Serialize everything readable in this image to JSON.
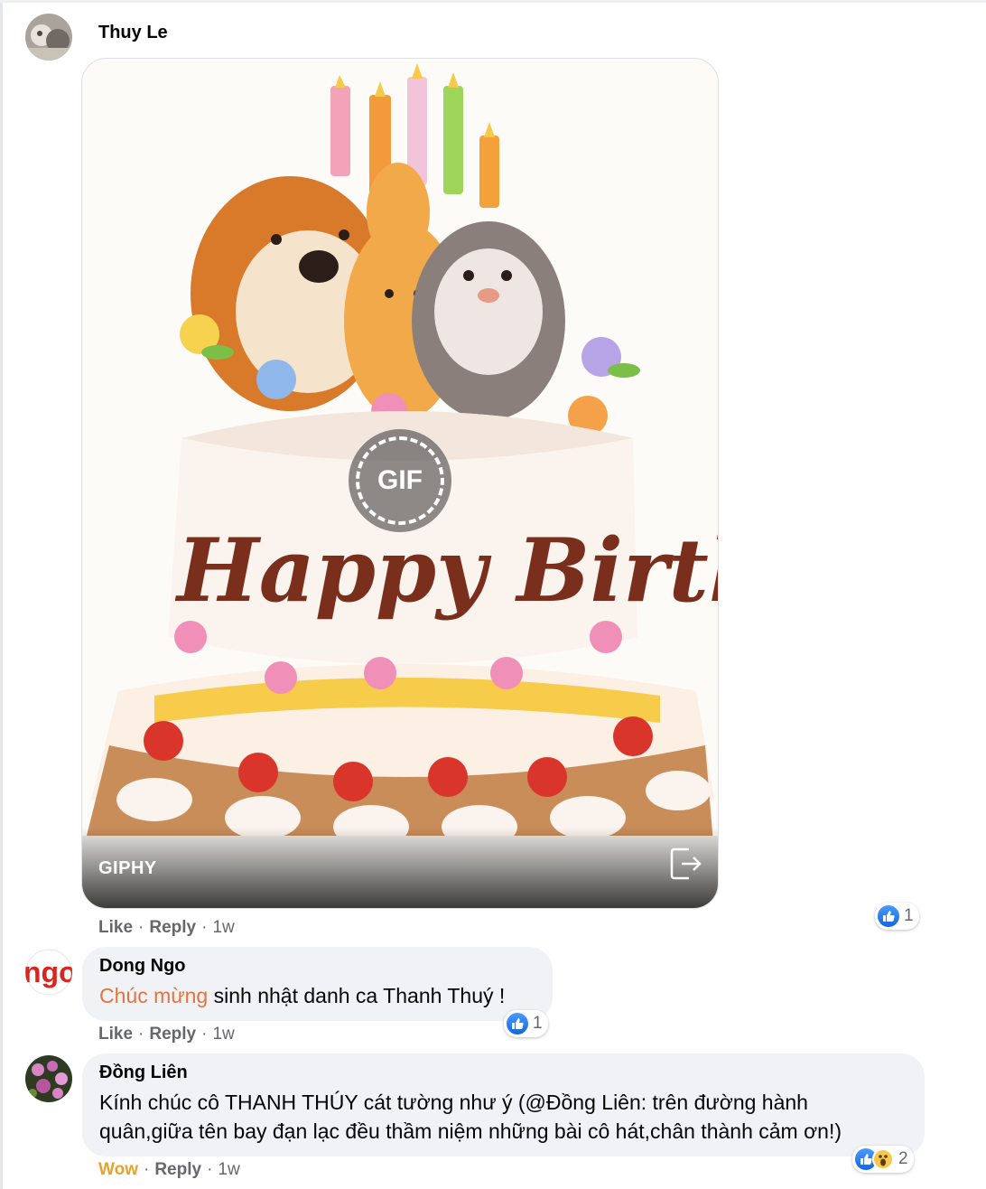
{
  "comments": [
    {
      "author": "Thuy Le",
      "media": {
        "type": "gif",
        "provider": "GIPHY",
        "badge": "GIF",
        "caption_art": "Happy Birthday"
      },
      "actions": {
        "like": "Like",
        "reply": "Reply",
        "time": "1w"
      },
      "reactions": {
        "count": "1",
        "types": [
          "like-icon"
        ]
      }
    },
    {
      "author": "Dong Ngo",
      "text_highlight": "Chúc mừng",
      "text_rest": " sinh nhật danh ca Thanh Thuý !",
      "actions": {
        "like": "Like",
        "reply": "Reply",
        "time": "1w"
      },
      "reactions": {
        "count": "1",
        "types": [
          "like-icon"
        ]
      }
    },
    {
      "author": "Đồng Liên",
      "text_line1": "Kính chúc cô THANH THÚY cát tường như ý (@Đồng Liên: trên đường hành",
      "text_line2": "quân,giữa tên bay đạn lạc đều thầm niệm những bài cô hát,chân thành cảm ơn!)",
      "actions": {
        "like": "Wow",
        "reply": "Reply",
        "time": "1w"
      },
      "reactions": {
        "count": "2",
        "types": [
          "like-icon",
          "wow-icon"
        ]
      }
    }
  ],
  "colors": {
    "bubble": "#f0f2f5",
    "link_highlight": "#e4743d",
    "wow_label": "#e7a22c",
    "like_blue": "#1877f2",
    "meta_gray": "#65676b"
  }
}
